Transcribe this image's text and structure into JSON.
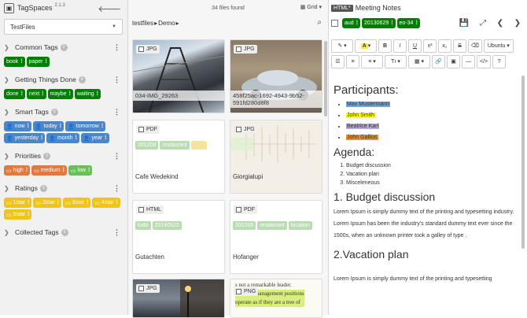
{
  "left": {
    "app_name": "TagSpaces",
    "version": "2.1.3",
    "location": "TestFiles",
    "groups": [
      {
        "title": "Common Tags",
        "count": "2",
        "tags": [
          {
            "label": "book",
            "color": "#008000"
          },
          {
            "label": "paper",
            "color": "#008000"
          }
        ]
      },
      {
        "title": "Getting Things Done",
        "count": "4",
        "tags": [
          {
            "label": "done",
            "color": "#008000"
          },
          {
            "label": "next",
            "color": "#008000"
          },
          {
            "label": "maybe",
            "color": "#008000"
          },
          {
            "label": "waiting",
            "color": "#008000"
          }
        ]
      },
      {
        "title": "Smart Tags",
        "count": "5",
        "tags": [
          {
            "label": "now",
            "color": "#4a86c8"
          },
          {
            "label": "today",
            "color": "#4a86c8"
          },
          {
            "label": "tomorrow",
            "color": "#4a86c8"
          },
          {
            "label": "yesterday",
            "color": "#4a86c8"
          },
          {
            "label": "month",
            "color": "#4a86c8"
          },
          {
            "label": "year",
            "color": "#4a86c8"
          }
        ]
      },
      {
        "title": "Priorities",
        "count": "3",
        "tags": [
          {
            "label": "high",
            "color": "#e07a3e"
          },
          {
            "label": "medium",
            "color": "#e07a3e"
          },
          {
            "label": "low",
            "color": "#6bbf59"
          }
        ]
      },
      {
        "title": "Ratings",
        "count": "5",
        "tags": [
          {
            "label": "1star",
            "color": "#f0c419"
          },
          {
            "label": "2star",
            "color": "#f0c419"
          },
          {
            "label": "3star",
            "color": "#f0c419"
          },
          {
            "label": "4star",
            "color": "#f0c419"
          },
          {
            "label": "5star",
            "color": "#f0c419"
          }
        ]
      },
      {
        "title": "Collected Tags",
        "count": "0",
        "tags": []
      }
    ]
  },
  "mid": {
    "files_found": "34 files found",
    "view_mode": "Grid",
    "breadcrumb": [
      "testfiles",
      "Demo"
    ],
    "cards": [
      {
        "ext": "JPG",
        "name": "034-IMG_29263",
        "tags": []
      },
      {
        "ext": "JPG",
        "name": "458f25ac-1692-4943-9b52-591fd280d8f8",
        "tags": []
      },
      {
        "ext": "PDF",
        "name": "Cafe Wedekind",
        "tags": [
          "201208",
          "restaurant",
          ""
        ]
      },
      {
        "ext": "JPG",
        "name": "Giorgialupi",
        "tags": []
      },
      {
        "ext": "HTML",
        "name": "Gutachten",
        "tags": [
          "todo",
          "20140522"
        ]
      },
      {
        "ext": "PDF",
        "name": "Hofanger",
        "tags": [
          "201205",
          "restaurant",
          "location"
        ]
      },
      {
        "ext": "JPG",
        "name": "",
        "tags": []
      },
      {
        "ext": "PNG",
        "name": "",
        "tags": [],
        "preview": [
          "s not a remarkable leader.",
          "Some in management positions",
          "operate as if they are a tree of"
        ]
      }
    ]
  },
  "right": {
    "file_type": "HTML*",
    "title": "Meeting Notes",
    "tags": [
      "aud",
      "20130629",
      "eo-34"
    ],
    "font": "Ubuntu",
    "heading_participants": "Participants:",
    "participants": [
      {
        "name": "Max Mustermann",
        "color": "#6fa8dc"
      },
      {
        "name": "John Smith",
        "color": "#ffff00"
      },
      {
        "name": "Beatrice Karl",
        "color": "#b4a7d6"
      },
      {
        "name": "John Gallius",
        "color": "#e69138"
      }
    ],
    "heading_agenda": "Agenda:",
    "agenda": [
      "Budget discussion",
      "Vacation plan",
      "Misceleneous"
    ],
    "heading_budget": "1. Budget discussion",
    "paragraph": "Lorem Ipsum is simply dummy text of the printing and typesetting industry. Lorem Ipsum has been the industry's standard dummy text ever since the 1500s, when an unknown printer took a galley of type .",
    "heading_vacation": "2.Vacation plan",
    "paragraph2": "Lorem Ipsum is simply dummy text of the printing and typesetting"
  }
}
